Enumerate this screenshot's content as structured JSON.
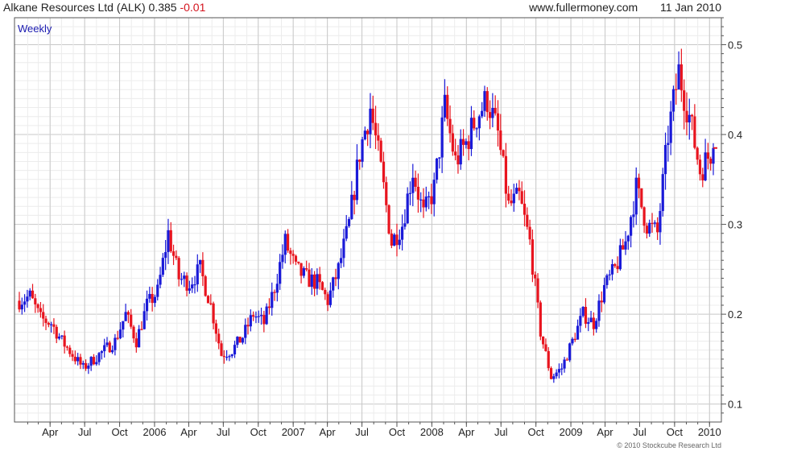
{
  "header": {
    "title": "Alkane Resources Ltd (ALK)",
    "price": "0.385",
    "change": "-0.01",
    "site": "www.fullermoney.com",
    "date": "11 Jan 2010"
  },
  "copyright": "© 2010 Stockcube Research Ltd",
  "colors": {
    "up": "#1a1ad8",
    "down": "#e8141e",
    "grid": "#d9d9d9",
    "frame": "#555555"
  },
  "chart_data": {
    "type": "ohlc",
    "period_label": "Weekly",
    "ylim": [
      0.08,
      0.53
    ],
    "y_ticks": [
      0.1,
      0.2,
      0.3,
      0.4,
      0.5
    ],
    "y_tick_labels": [
      "0.1",
      "0.2",
      "0.3",
      "0.4",
      "0.5"
    ],
    "x_range": [
      "2005-01-10",
      "2010-01-11"
    ],
    "x_ticks": [
      {
        "date": "2005-04-01",
        "label": "Apr"
      },
      {
        "date": "2005-07-01",
        "label": "Jul"
      },
      {
        "date": "2005-10-01",
        "label": "Oct"
      },
      {
        "date": "2006-01-01",
        "label": "2006"
      },
      {
        "date": "2006-04-01",
        "label": "Apr"
      },
      {
        "date": "2006-07-01",
        "label": "Jul"
      },
      {
        "date": "2006-10-01",
        "label": "Oct"
      },
      {
        "date": "2007-01-01",
        "label": "2007"
      },
      {
        "date": "2007-04-01",
        "label": "Apr"
      },
      {
        "date": "2007-07-01",
        "label": "Jul"
      },
      {
        "date": "2007-10-01",
        "label": "Oct"
      },
      {
        "date": "2008-01-01",
        "label": "2008"
      },
      {
        "date": "2008-04-01",
        "label": "Apr"
      },
      {
        "date": "2008-07-01",
        "label": "Jul"
      },
      {
        "date": "2008-10-01",
        "label": "Oct"
      },
      {
        "date": "2009-01-01",
        "label": "2009"
      },
      {
        "date": "2009-04-01",
        "label": "Apr"
      },
      {
        "date": "2009-07-01",
        "label": "Jul"
      },
      {
        "date": "2009-10-01",
        "label": "Oct"
      },
      {
        "date": "2010-01-01",
        "label": "2010"
      }
    ],
    "closes": [
      [
        "2005-01-10",
        0.215
      ],
      [
        "2005-02-07",
        0.22
      ],
      [
        "2005-03-07",
        0.195
      ],
      [
        "2005-04-04",
        0.19
      ],
      [
        "2005-05-02",
        0.17
      ],
      [
        "2005-05-30",
        0.155
      ],
      [
        "2005-06-27",
        0.14
      ],
      [
        "2005-07-25",
        0.15
      ],
      [
        "2005-08-22",
        0.16
      ],
      [
        "2005-09-19",
        0.17
      ],
      [
        "2005-10-17",
        0.2
      ],
      [
        "2005-11-14",
        0.17
      ],
      [
        "2005-12-12",
        0.21
      ],
      [
        "2006-01-09",
        0.225
      ],
      [
        "2006-02-06",
        0.29
      ],
      [
        "2006-03-06",
        0.24
      ],
      [
        "2006-04-03",
        0.235
      ],
      [
        "2006-05-01",
        0.25
      ],
      [
        "2006-05-29",
        0.21
      ],
      [
        "2006-06-26",
        0.155
      ],
      [
        "2006-07-24",
        0.16
      ],
      [
        "2006-08-21",
        0.175
      ],
      [
        "2006-09-18",
        0.2
      ],
      [
        "2006-10-16",
        0.19
      ],
      [
        "2006-11-13",
        0.23
      ],
      [
        "2006-12-11",
        0.28
      ],
      [
        "2007-01-08",
        0.25
      ],
      [
        "2007-02-05",
        0.24
      ],
      [
        "2007-03-05",
        0.235
      ],
      [
        "2007-04-02",
        0.215
      ],
      [
        "2007-04-30",
        0.25
      ],
      [
        "2007-05-28",
        0.3
      ],
      [
        "2007-06-25",
        0.38
      ],
      [
        "2007-07-23",
        0.43
      ],
      [
        "2007-08-20",
        0.36
      ],
      [
        "2007-09-17",
        0.28
      ],
      [
        "2007-10-15",
        0.3
      ],
      [
        "2007-11-12",
        0.36
      ],
      [
        "2007-12-10",
        0.31
      ],
      [
        "2008-01-07",
        0.34
      ],
      [
        "2008-02-04",
        0.43
      ],
      [
        "2008-03-03",
        0.37
      ],
      [
        "2008-03-31",
        0.39
      ],
      [
        "2008-04-28",
        0.42
      ],
      [
        "2008-05-26",
        0.44
      ],
      [
        "2008-06-23",
        0.4
      ],
      [
        "2008-07-21",
        0.32
      ],
      [
        "2008-08-18",
        0.33
      ],
      [
        "2008-09-15",
        0.28
      ],
      [
        "2008-10-13",
        0.18
      ],
      [
        "2008-11-10",
        0.13
      ],
      [
        "2008-12-08",
        0.14
      ],
      [
        "2009-01-05",
        0.17
      ],
      [
        "2009-02-02",
        0.2
      ],
      [
        "2009-03-02",
        0.19
      ],
      [
        "2009-03-30",
        0.23
      ],
      [
        "2009-04-27",
        0.25
      ],
      [
        "2009-05-25",
        0.28
      ],
      [
        "2009-06-22",
        0.34
      ],
      [
        "2009-07-20",
        0.3
      ],
      [
        "2009-08-17",
        0.29
      ],
      [
        "2009-09-14",
        0.4
      ],
      [
        "2009-10-12",
        0.47
      ],
      [
        "2009-11-09",
        0.42
      ],
      [
        "2009-12-07",
        0.36
      ],
      [
        "2010-01-11",
        0.385
      ]
    ]
  }
}
